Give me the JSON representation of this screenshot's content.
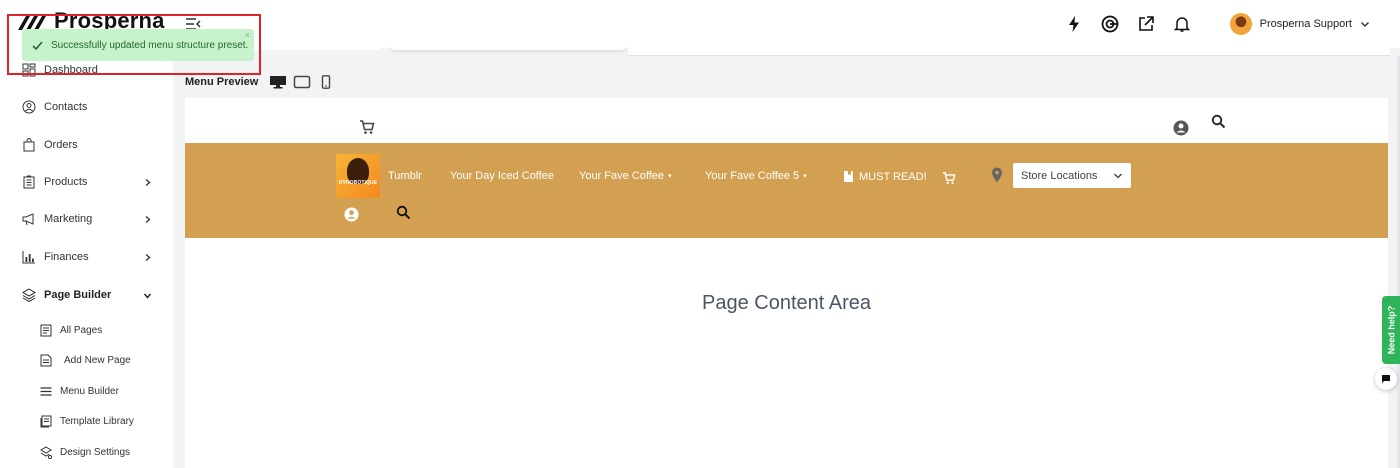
{
  "app": {
    "logo_text": "Prosperna"
  },
  "header": {
    "user_name": "Prosperna Support",
    "icons": [
      "bolt-icon",
      "target-icon",
      "external-link-icon",
      "bell-icon"
    ]
  },
  "toast": {
    "message": "Successfully updated menu structure preset.",
    "close": "×"
  },
  "sidebar": {
    "items": [
      {
        "label": "Dashboard",
        "icon": "dashboard-icon"
      },
      {
        "label": "Contacts",
        "icon": "contacts-icon"
      },
      {
        "label": "Orders",
        "icon": "orders-icon"
      },
      {
        "label": "Products",
        "icon": "products-icon"
      },
      {
        "label": "Marketing",
        "icon": "megaphone-icon"
      },
      {
        "label": "Finances",
        "icon": "bar-chart-icon"
      },
      {
        "label": "Page Builder",
        "icon": "layers-icon"
      }
    ],
    "page_builder_children": [
      {
        "label": "All Pages"
      },
      {
        "label": "Add New Page"
      },
      {
        "label": "Menu Builder"
      },
      {
        "label": "Template Library"
      },
      {
        "label": "Design Settings"
      }
    ]
  },
  "preview": {
    "title": "Menu Preview",
    "devices": [
      "desktop-icon",
      "tablet-icon",
      "mobile-icon"
    ],
    "brand_name": "DYNOBOTIQUE",
    "menu": {
      "tumblr": "Tumblr",
      "iced": "Your Day Iced Coffee",
      "fave": "Your Fave Coffee",
      "fave5": "Your Fave Coffee 5",
      "must_read": "MUST READ!"
    },
    "store_select": "Store Locations",
    "content_area": "Page Content Area"
  },
  "widgets": {
    "need_help": "Need help?"
  },
  "colors": {
    "menu_bar": "#d3a052",
    "toast_bg": "#c7f3cc",
    "toast_outline": "#e0232b",
    "help_tab": "#2fb45a"
  }
}
